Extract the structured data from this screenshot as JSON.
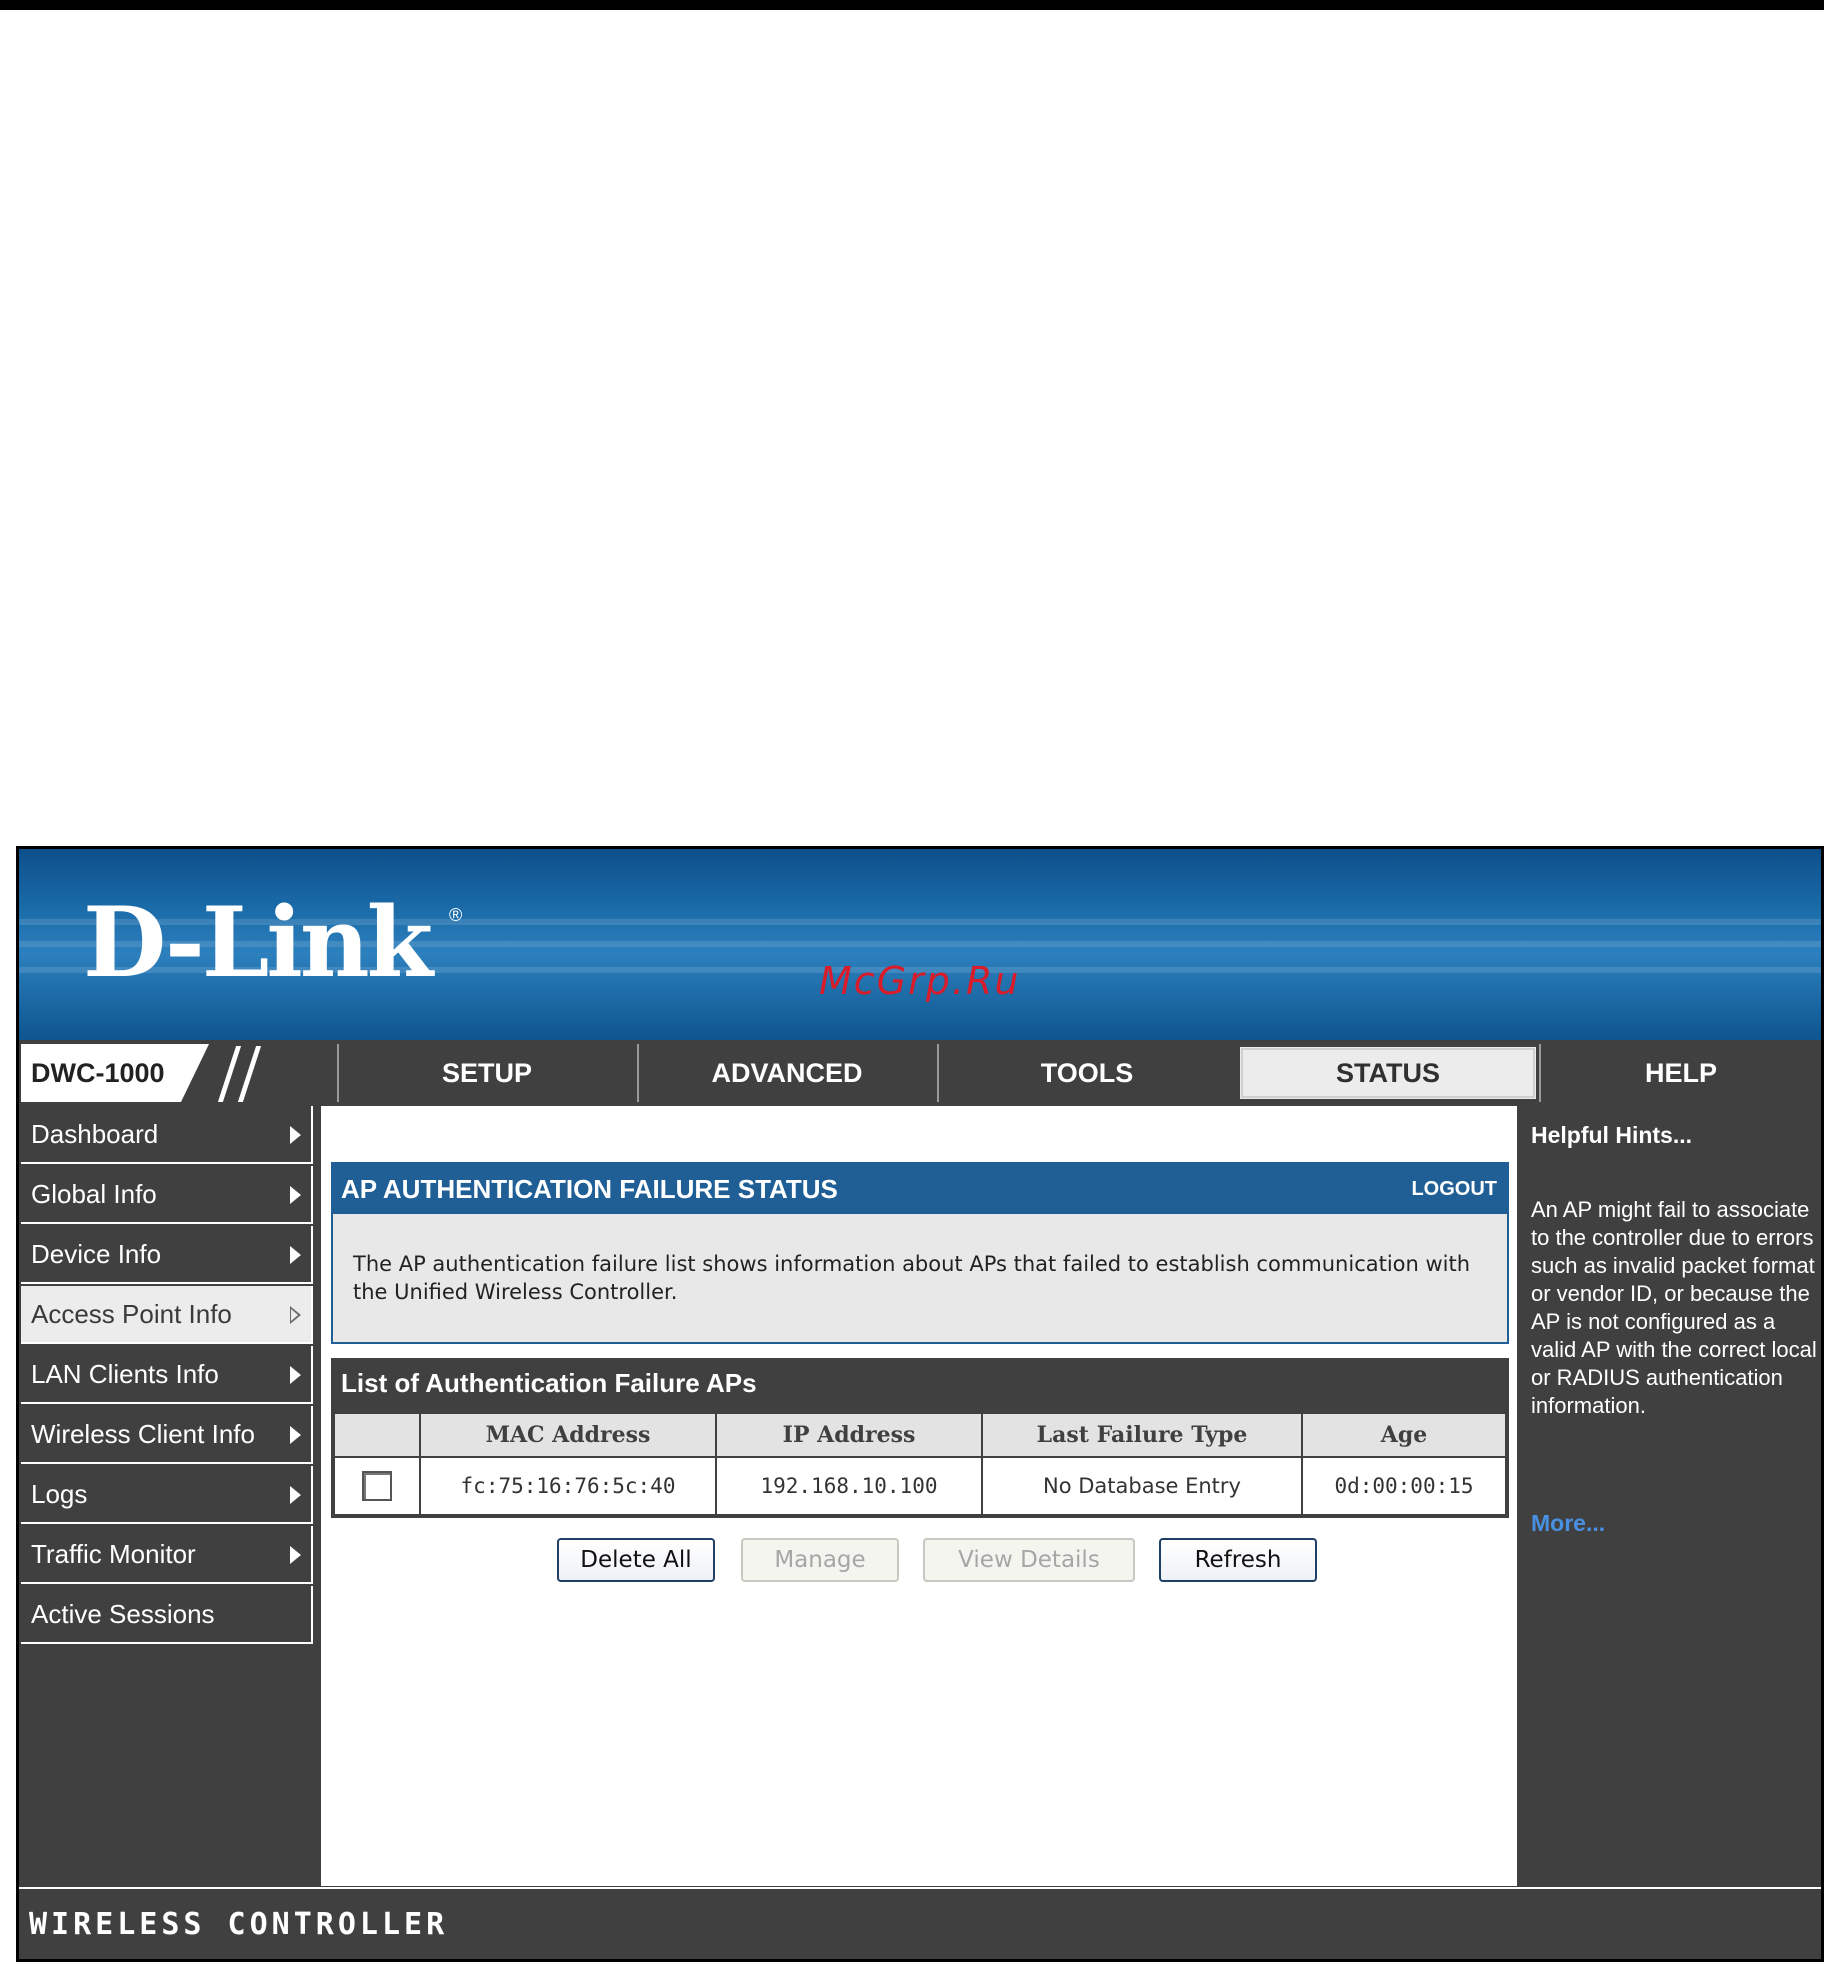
{
  "header": {
    "brand": "D-Link",
    "registered_mark": "®",
    "watermark": "McGrp.Ru"
  },
  "nav": {
    "model": "DWC-1000",
    "tabs": [
      {
        "label": "SETUP",
        "active": false
      },
      {
        "label": "ADVANCED",
        "active": false
      },
      {
        "label": "TOOLS",
        "active": false
      },
      {
        "label": "STATUS",
        "active": true
      },
      {
        "label": "HELP",
        "active": false
      }
    ]
  },
  "sidebar": {
    "items": [
      {
        "label": "Dashboard",
        "arrow": true,
        "active": false
      },
      {
        "label": "Global Info",
        "arrow": true,
        "active": false
      },
      {
        "label": "Device Info",
        "arrow": true,
        "active": false
      },
      {
        "label": "Access Point Info",
        "arrow": true,
        "active": true
      },
      {
        "label": "LAN Clients Info",
        "arrow": true,
        "active": false
      },
      {
        "label": "Wireless Client Info",
        "arrow": true,
        "active": false
      },
      {
        "label": "Logs",
        "arrow": true,
        "active": false
      },
      {
        "label": "Traffic Monitor",
        "arrow": true,
        "active": false
      },
      {
        "label": "Active Sessions",
        "arrow": false,
        "active": false
      }
    ]
  },
  "main": {
    "panel_title": "AP AUTHENTICATION FAILURE STATUS",
    "logout_label": "LOGOUT",
    "description": "The AP authentication failure list shows information about APs that failed to establish communication with the Unified Wireless Controller.",
    "list_title": "List of Authentication Failure APs",
    "columns": [
      "",
      "MAC Address",
      "IP Address",
      "Last Failure Type",
      "Age"
    ],
    "rows": [
      {
        "mac": "fc:75:16:76:5c:40",
        "ip": "192.168.10.100",
        "failure": "No Database Entry",
        "age": "0d:00:00:15",
        "checked": false
      }
    ],
    "buttons": {
      "delete_all": "Delete All",
      "manage": "Manage",
      "view_details": "View Details",
      "refresh": "Refresh"
    }
  },
  "help": {
    "title": "Helpful Hints...",
    "text": "An AP might fail to associate to the controller due to errors such as invalid packet format or vendor ID, or because the AP is not configured as a valid AP with the correct local or RADIUS authentication information.",
    "more": "More..."
  },
  "footer": {
    "text": "WIRELESS CONTROLLER"
  },
  "colors": {
    "banner_blue": "#1a6aa8",
    "panel_blue": "#1f5f96",
    "dark_gray": "#404040",
    "link_blue": "#4a90e2",
    "watermark_red": "#d81c2a"
  }
}
